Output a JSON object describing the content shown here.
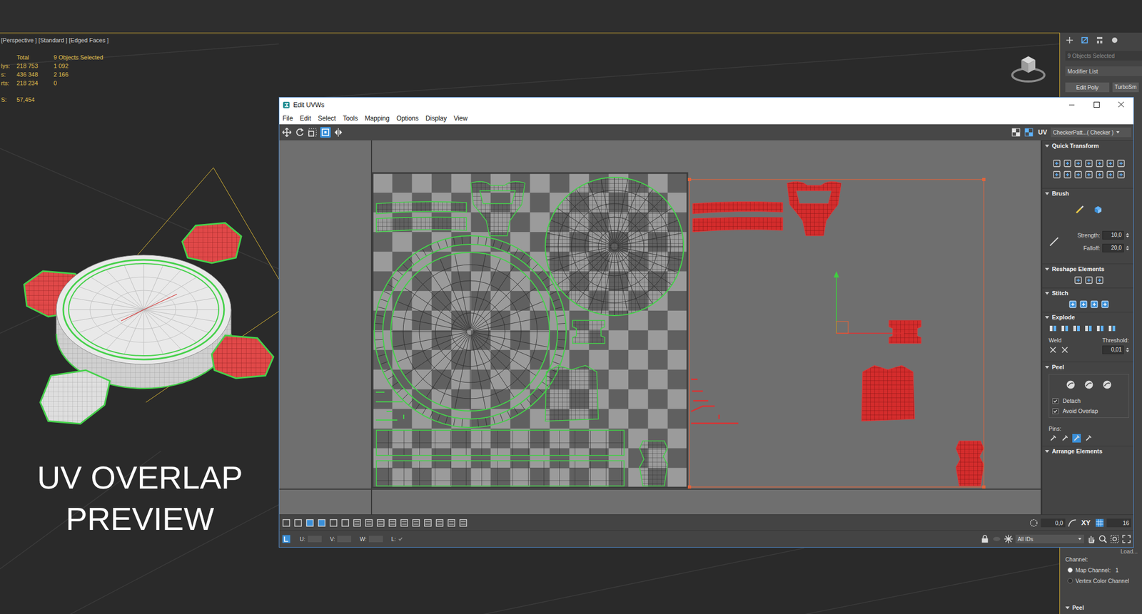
{
  "viewport": {
    "label": "[Perspective ] [Standard ] [Edged Faces ]",
    "stats": {
      "header": {
        "total": "Total",
        "selected": "9 Objects Selected"
      },
      "rows": [
        {
          "label": "lys:",
          "total": "218 753",
          "selected": "1 092"
        },
        {
          "label": "s:",
          "total": "436 348",
          "selected": "2 166"
        },
        {
          "label": "rts:",
          "total": "218 234",
          "selected": "0"
        }
      ],
      "fps": {
        "label": "S:",
        "value": "57,454"
      }
    },
    "caption": [
      "UV OVERLAP",
      "PREVIEW"
    ]
  },
  "command_panel": {
    "selection": "9 Objects Selected",
    "modifier_list": "Modifier List",
    "modifiers": [
      "Edit Poly",
      "TurboSm"
    ],
    "load": "Load...",
    "channel_label": "Channel:",
    "channels": [
      {
        "label": "Map Channel:",
        "value": "1",
        "selected": true
      },
      {
        "label": "Vertex Color Channel",
        "selected": false
      }
    ],
    "next_rollout": "Peel"
  },
  "uv_window": {
    "title": "Edit UVWs",
    "menu": [
      "File",
      "Edit",
      "Select",
      "Tools",
      "Mapping",
      "Options",
      "Display",
      "View"
    ],
    "toolbar": {
      "mode": "UV",
      "texture": "CheckerPatt...( Checker )"
    },
    "rollouts": [
      {
        "title": "Quick Transform",
        "kind": "icons"
      },
      {
        "title": "Brush",
        "kind": "brush",
        "fields": [
          {
            "label": "Strength:",
            "value": "10,0"
          },
          {
            "label": "Falloff:",
            "value": "20,0"
          }
        ]
      },
      {
        "title": "Reshape Elements",
        "kind": "icons"
      },
      {
        "title": "Stitch",
        "kind": "icons"
      },
      {
        "title": "Explode",
        "kind": "explode",
        "weld": "Weld",
        "fields": [
          {
            "label": "Threshold:",
            "value": "0,01"
          }
        ]
      },
      {
        "title": "Peel",
        "kind": "peel",
        "checks": [
          {
            "label": "Detach",
            "checked": true
          },
          {
            "label": "Avoid Overlap",
            "checked": true
          }
        ],
        "pins": "Pins:"
      },
      {
        "title": "Arrange Elements",
        "kind": "header"
      }
    ],
    "bottom_toolbar": {
      "angle": "0,0",
      "axis": "XY",
      "grid": "16"
    },
    "status": {
      "coords": [
        {
          "label": "U:"
        },
        {
          "label": "V:"
        },
        {
          "label": "W:"
        }
      ],
      "lock": {
        "label": "L:",
        "checked": true
      },
      "filter": "All IDs"
    }
  }
}
